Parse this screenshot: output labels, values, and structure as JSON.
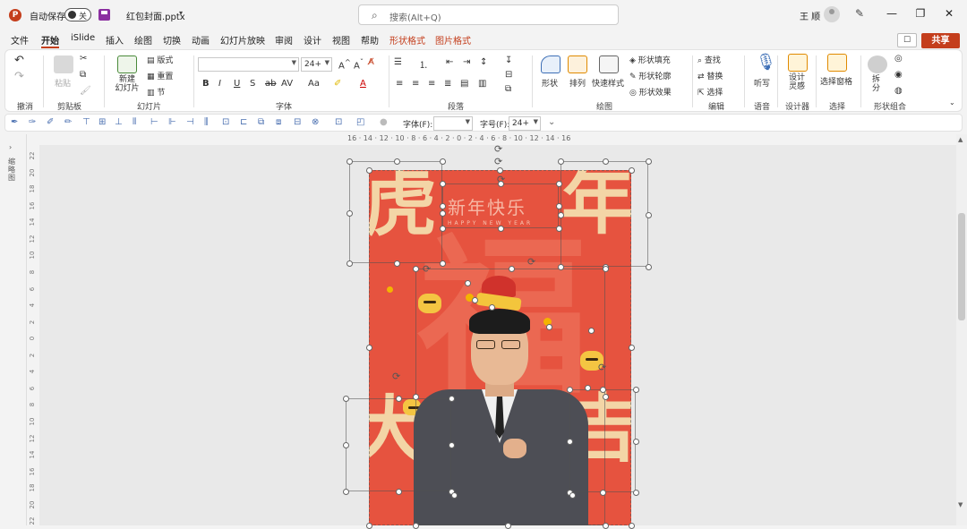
{
  "titlebar": {
    "app_icon": "P",
    "autosave_label": "自动保存",
    "autosave_state": "关",
    "filename": "红包封面.pptx",
    "search_placeholder": "搜索(Alt+Q)",
    "user_name": "王 顺"
  },
  "menu": {
    "tabs": [
      "文件",
      "开始",
      "iSlide",
      "插入",
      "绘图",
      "切换",
      "动画",
      "幻灯片放映",
      "审阅",
      "设计",
      "视图",
      "帮助",
      "形状格式",
      "图片格式"
    ],
    "active": "开始",
    "share": "共享"
  },
  "ribbon": {
    "groups": {
      "undo": "撤消",
      "clipboard": "剪贴板",
      "slides": "幻灯片",
      "font": "字体",
      "paragraph": "段落",
      "drawing": "绘图",
      "editing": "编辑",
      "voice": "语音",
      "designer": "设计器",
      "select": "选择",
      "shape_combine": "形状组合"
    },
    "paste": "粘贴",
    "new_slide": "新建\n幻灯片",
    "layout": "版式",
    "reset": "重置",
    "section": "节",
    "font_size": "24+",
    "shape": "形状",
    "arrange": "排列",
    "quick_styles": "快速样式",
    "shape_fill": "形状填充",
    "shape_outline": "形状轮廓",
    "shape_effects": "形状效果",
    "find": "查找",
    "replace": "替换",
    "select_btn": "选择",
    "dictate": "听写",
    "design_ideas": "设计\n灵感",
    "selection_pane": "选择窗格",
    "split": "拆\n分"
  },
  "toolbar2": {
    "font_label": "字体(F):",
    "size_label": "字号(F):",
    "size_value": "24+"
  },
  "left_pane": {
    "label": "缩略图"
  },
  "ruler": {
    "h_ticks": "16 · 14 · 12 · 10 · 8 · 6 · 4 · 2 · 0 · 2 · 4 · 6 · 8 · 10 · 12 · 14 · 16",
    "v_ticks": [
      "22",
      "20",
      "18",
      "16",
      "14",
      "12",
      "10",
      "8",
      "6",
      "4",
      "2",
      "0",
      "2",
      "4",
      "6",
      "8",
      "10",
      "12",
      "14",
      "16",
      "18",
      "20",
      "22"
    ]
  },
  "slide": {
    "bg_color": "#e6533f",
    "big_char": "福",
    "corner_tl": "虎",
    "corner_tr": "年",
    "corner_bl": "大",
    "corner_br": "吉",
    "slogan": "新年快乐",
    "slogan_en": "HAPPY NEW YEAR"
  }
}
